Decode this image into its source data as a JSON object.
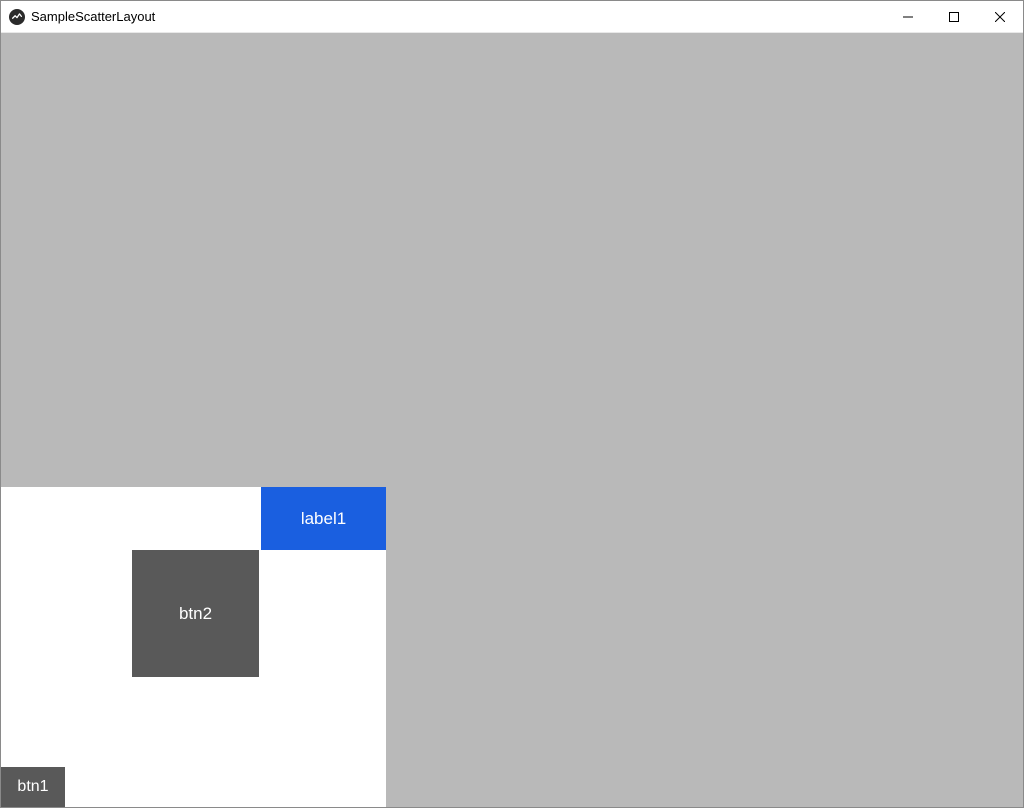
{
  "window": {
    "title": "SampleScatterLayout"
  },
  "controls": {
    "minimize_glyph": "—",
    "maximize_glyph": "☐",
    "close_glyph": "✕"
  },
  "widgets": {
    "label1": {
      "text": "label1"
    },
    "btn2": {
      "text": "btn2"
    },
    "btn1": {
      "text": "btn1"
    }
  },
  "colors": {
    "canvas_bg": "#b9b9b9",
    "panel_bg": "#ffffff",
    "label_bg": "#1a5fe0",
    "button_bg": "#595959",
    "fg": "#ffffff"
  }
}
